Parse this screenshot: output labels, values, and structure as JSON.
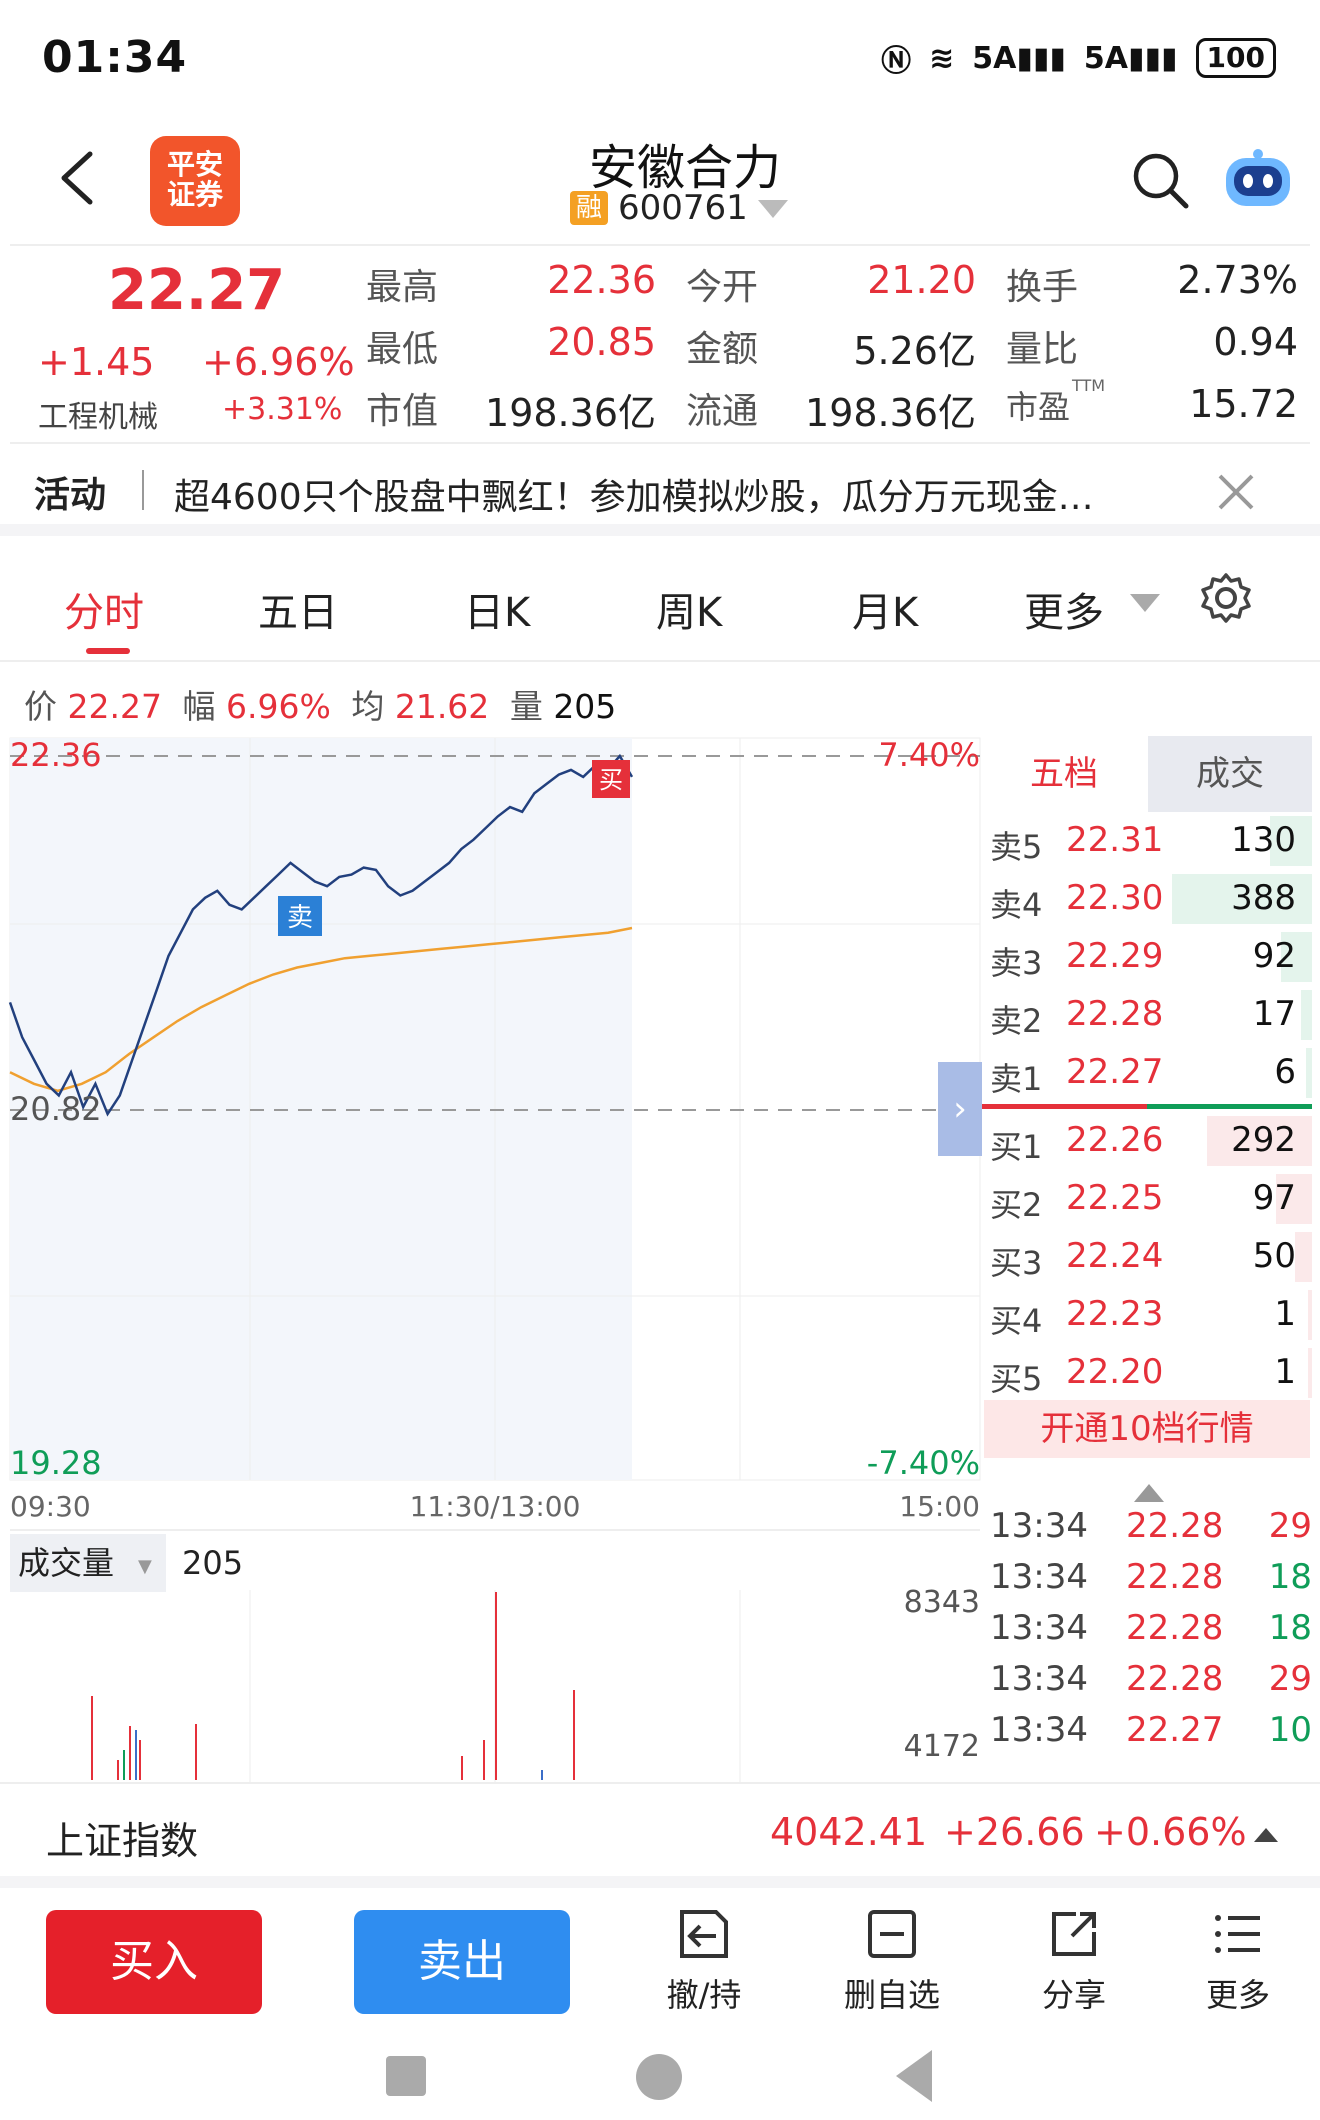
{
  "status_bar": {
    "time": "01:34",
    "network": "5A",
    "battery": "100"
  },
  "header": {
    "logo_text": "平安证券",
    "title": "安徽合力",
    "rong": "融",
    "code": "600761"
  },
  "quote": {
    "price": "22.27",
    "change": "+1.45",
    "change_pct": "+6.96%",
    "sector": "工程机械",
    "sector_pct": "+3.31%",
    "fields": [
      {
        "label": "最高",
        "value": "22.36",
        "color": "red"
      },
      {
        "label": "今开",
        "value": "21.20",
        "color": "red"
      },
      {
        "label": "换手",
        "value": "2.73%",
        "color": "black"
      },
      {
        "label": "最低",
        "value": "20.85",
        "color": "red"
      },
      {
        "label": "金额",
        "value": "5.26亿",
        "color": "black"
      },
      {
        "label": "量比",
        "value": "0.94",
        "color": "black"
      },
      {
        "label": "市值",
        "value": "198.36亿",
        "color": "black"
      },
      {
        "label": "流通",
        "value": "198.36亿",
        "color": "black"
      },
      {
        "label": "市盈",
        "value": "15.72",
        "color": "black"
      }
    ],
    "ttm": "TTM"
  },
  "activity": {
    "tag": "活动",
    "text": "超4600只个股盘中飘红！参加模拟炒股，瓜分万元现金…"
  },
  "tabs": [
    "分时",
    "五日",
    "日K",
    "周K",
    "月K",
    "更多"
  ],
  "infoline": {
    "price_label": "价",
    "price": "22.27",
    "amp_label": "幅",
    "amp": "6.96%",
    "avg_label": "均",
    "avg": "21.62",
    "vol_label": "量",
    "vol": "205"
  },
  "chart": {
    "y_top": "22.36",
    "y_mid": "20.82",
    "y_bottom": "19.28",
    "pct_top": "7.40%",
    "pct_bottom": "-7.40%",
    "x_labels": [
      "09:30",
      "11:30/13:00",
      "15:00"
    ],
    "sell_marker": "卖",
    "buy_marker": "买",
    "price_series": [
      21.3,
      21.15,
      21.05,
      20.95,
      20.9,
      21.0,
      20.85,
      20.95,
      20.82,
      20.9,
      21.05,
      21.2,
      21.35,
      21.5,
      21.6,
      21.7,
      21.75,
      21.78,
      21.72,
      21.7,
      21.75,
      21.8,
      21.85,
      21.9,
      21.86,
      21.82,
      21.8,
      21.84,
      21.85,
      21.88,
      21.87,
      21.8,
      21.76,
      21.78,
      21.82,
      21.86,
      21.9,
      21.96,
      22.0,
      22.05,
      22.1,
      22.14,
      22.12,
      22.2,
      22.24,
      22.28,
      22.3,
      22.27,
      22.32,
      22.3,
      22.36,
      22.27
    ],
    "avg_series": [
      21.0,
      20.95,
      20.92,
      20.95,
      21.0,
      21.08,
      21.15,
      21.22,
      21.28,
      21.33,
      21.38,
      21.42,
      21.45,
      21.47,
      21.49,
      21.5,
      21.51,
      21.52,
      21.53,
      21.54,
      21.55,
      21.56,
      21.57,
      21.58,
      21.59,
      21.6,
      21.62
    ],
    "volume_title": "成交量",
    "volume_value": "205",
    "volume_ticks": [
      "8343",
      "4172"
    ]
  },
  "orderbook": {
    "tab_active": "五档",
    "tab_other": "成交",
    "asks": [
      {
        "label": "卖5",
        "price": "22.31",
        "vol": "130",
        "bar": 0.3
      },
      {
        "label": "卖4",
        "price": "22.30",
        "vol": "388",
        "bar": 1.0
      },
      {
        "label": "卖3",
        "price": "22.29",
        "vol": "92",
        "bar": 0.22
      },
      {
        "label": "卖2",
        "price": "22.28",
        "vol": "17",
        "bar": 0.08
      },
      {
        "label": "卖1",
        "price": "22.27",
        "vol": "6",
        "bar": 0.04
      }
    ],
    "bids": [
      {
        "label": "买1",
        "price": "22.26",
        "vol": "292",
        "bar": 0.75
      },
      {
        "label": "买2",
        "price": "22.25",
        "vol": "97",
        "bar": 0.26
      },
      {
        "label": "买3",
        "price": "22.24",
        "vol": "50",
        "bar": 0.12
      },
      {
        "label": "买4",
        "price": "22.23",
        "vol": "1",
        "bar": 0.02
      },
      {
        "label": "买5",
        "price": "22.20",
        "vol": "1",
        "bar": 0.02
      }
    ],
    "open10": "开通10档行情",
    "trades": [
      {
        "time": "13:34",
        "price": "22.28",
        "vol": "29",
        "color": "red"
      },
      {
        "time": "13:34",
        "price": "22.28",
        "vol": "18",
        "color": "green"
      },
      {
        "time": "13:34",
        "price": "22.28",
        "vol": "18",
        "color": "green"
      },
      {
        "time": "13:34",
        "price": "22.28",
        "vol": "29",
        "color": "red"
      },
      {
        "time": "13:34",
        "price": "22.27",
        "vol": "10",
        "color": "green"
      }
    ]
  },
  "index_bar": {
    "name": "上证指数",
    "value": "4042.41",
    "change": "+26.66",
    "pct": "+0.66%"
  },
  "actions": {
    "buy": "买入",
    "sell": "卖出",
    "cancel": "撤/持",
    "remove": "删自选",
    "share": "分享",
    "more": "更多"
  }
}
